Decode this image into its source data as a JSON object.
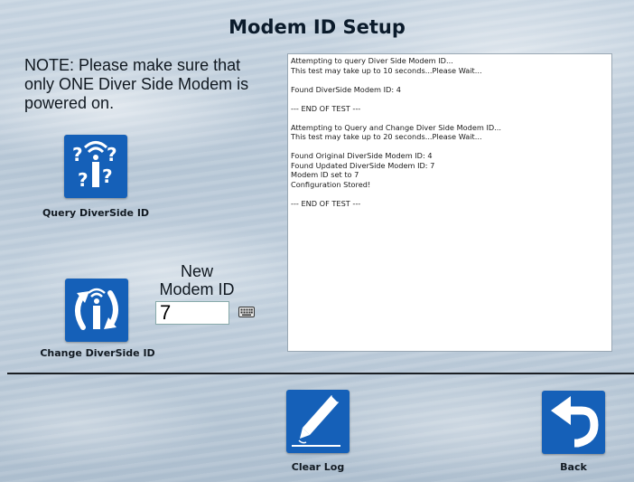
{
  "title": "Modem ID Setup",
  "note": "NOTE:  Please make sure that only ONE Diver Side Modem is powered on.",
  "buttons": {
    "query": "Query DiverSide ID",
    "change": "Change DiverSide ID",
    "clear_log": "Clear Log",
    "back": "Back"
  },
  "new_modem_id": {
    "label_line1": "New",
    "label_line2": "Modem ID",
    "value": "7"
  },
  "log_lines": [
    "Attempting to query Diver Side Modem ID...",
    "This test may take up to 10 seconds...Please Wait...",
    "",
    "Found DiverSide Modem ID: 4",
    "",
    "--- END OF TEST ---",
    "",
    "Attempting to Query and Change Diver Side Modem ID...",
    "This test may take up to 20 seconds...Please Wait...",
    "",
    "Found Original DiverSide Modem ID: 4",
    "Found Updated DiverSide Modem ID: 7",
    "Modem ID set to 7",
    "Configuration Stored!",
    "",
    "--- END OF TEST ---"
  ],
  "colors": {
    "button_blue": "#1560b8",
    "divider": "#1b1f24"
  },
  "icons": {
    "query": "modem-question-icon",
    "change": "modem-refresh-icon",
    "clear_log": "pencil-eraser-icon",
    "back": "back-arrow-icon",
    "keyboard": "keyboard-icon"
  }
}
